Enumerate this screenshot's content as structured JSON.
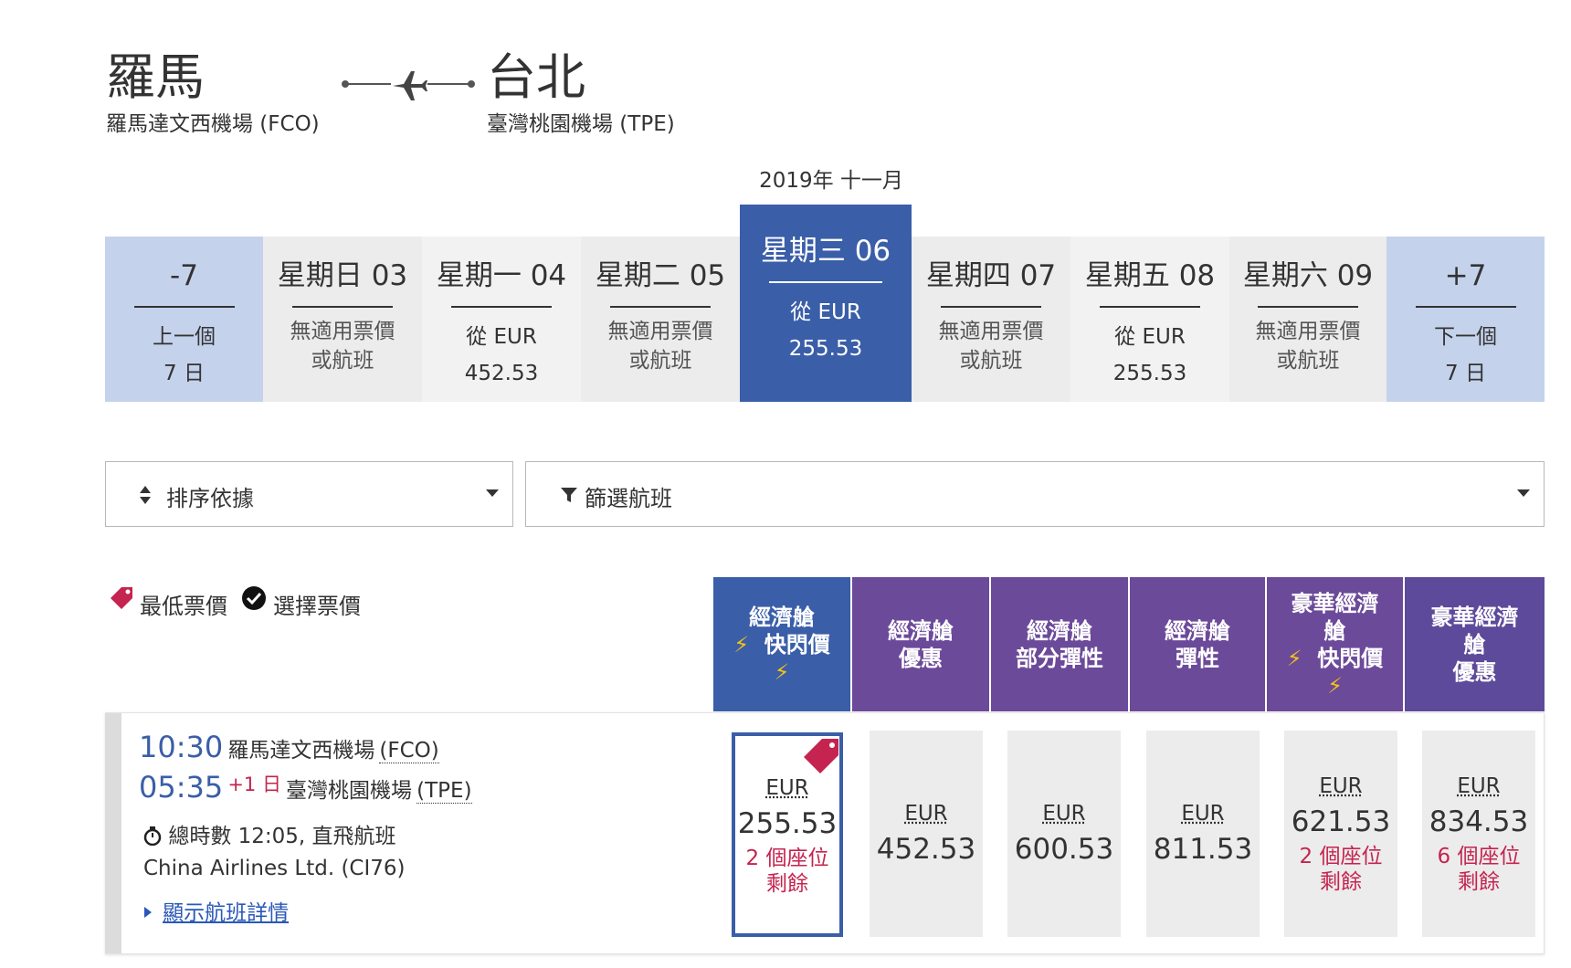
{
  "route": {
    "origin_city": "羅馬",
    "origin_airport": "羅馬達文西機場 (FCO)",
    "destination_city": "台北",
    "destination_airport": "臺灣桃園機場 (TPE)"
  },
  "calendar": {
    "month": "2019年 十一月",
    "prev": {
      "head": "-7",
      "line1": "上一個",
      "line2": "7 日"
    },
    "next": {
      "head": "+7",
      "line1": "下一個",
      "line2": "7 日"
    },
    "days": [
      {
        "head": "星期日 03",
        "line1": "無適用票價",
        "line2": "或航班",
        "state": "na"
      },
      {
        "head": "星期一 04",
        "line1": "從 EUR",
        "line2": "452.53",
        "state": "avail"
      },
      {
        "head": "星期二 05",
        "line1": "無適用票價",
        "line2": "或航班",
        "state": "na"
      },
      {
        "head": "星期三 06",
        "line1": "從 EUR",
        "line2": "255.53",
        "state": "selected"
      },
      {
        "head": "星期四 07",
        "line1": "無適用票價",
        "line2": "或航班",
        "state": "na"
      },
      {
        "head": "星期五 08",
        "line1": "從 EUR",
        "line2": "255.53",
        "state": "avail"
      },
      {
        "head": "星期六 09",
        "line1": "無適用票價",
        "line2": "或航班",
        "state": "na"
      }
    ]
  },
  "controls": {
    "sort_label": "排序依據",
    "filter_label": "篩選航班"
  },
  "legend": {
    "lowest": "最低票價",
    "selected": "選擇票價"
  },
  "fare_classes": [
    {
      "line1": "經濟艙",
      "line2": "快閃價",
      "bolts": true
    },
    {
      "line1": "經濟艙",
      "line2": "優惠",
      "bolts": false
    },
    {
      "line1": "經濟艙",
      "line2": "部分彈性",
      "bolts": false
    },
    {
      "line1": "經濟艙",
      "line2": "彈性",
      "bolts": false
    },
    {
      "line1": "豪華經濟",
      "line1b": "艙",
      "line2": "快閃價",
      "bolts": true
    },
    {
      "line1": "豪華經濟",
      "line1b": "艙",
      "line2": "優惠",
      "bolts": false
    }
  ],
  "flight": {
    "depart_time": "10:30",
    "depart_airport": "羅馬達文西機場",
    "depart_code": "(FCO)",
    "arrive_time": "05:35",
    "day_offset": "+1 日",
    "arrive_airport": "臺灣桃園機場",
    "arrive_code": "(TPE)",
    "duration": "總時數 12:05, 直飛航班",
    "carrier": "China Airlines Ltd. (CI76)",
    "details_link": "顯示航班詳情"
  },
  "prices": [
    {
      "currency": "EUR",
      "amount": "255.53",
      "seats1": "2 個座位",
      "seats2": "剩餘",
      "selected": true
    },
    {
      "currency": "EUR",
      "amount": "452.53",
      "seats1": "",
      "seats2": ""
    },
    {
      "currency": "EUR",
      "amount": "600.53",
      "seats1": "",
      "seats2": ""
    },
    {
      "currency": "EUR",
      "amount": "811.53",
      "seats1": "",
      "seats2": ""
    },
    {
      "currency": "EUR",
      "amount": "621.53",
      "seats1": "2 個座位",
      "seats2": "剩餘"
    },
    {
      "currency": "EUR",
      "amount": "834.53",
      "seats1": "6 個座位",
      "seats2": "剩餘"
    }
  ],
  "colors": {
    "primary_blue": "#3a5ea8",
    "nav_blue": "#c5d2ec",
    "fare_purple": "#6c4a9a",
    "alert_red": "#c4244f",
    "bolt_yellow": "#f2c21b"
  }
}
